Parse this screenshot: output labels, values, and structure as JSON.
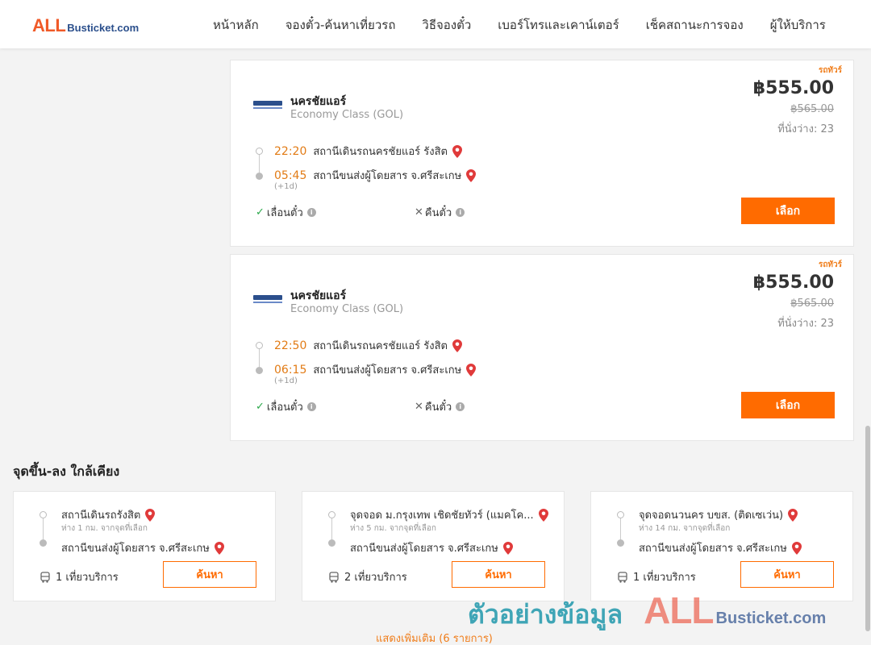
{
  "header": {
    "logo_all": "ALL",
    "logo_rest": "Busticket.com",
    "nav": [
      "หน้าหลัก",
      "จองตั๋ว-ค้นหาเที่ยวรถ",
      "วิธีจองตั๋ว",
      "เบอร์โทรและเคาน์เตอร์",
      "เช็คสถานะการจอง",
      "ผู้ให้บริการ"
    ]
  },
  "results": [
    {
      "badge": "รถทัวร์",
      "operator": "นครชัยแอร์",
      "class": "Economy Class (GOL)",
      "price": "฿555.00",
      "old_price": "฿565.00",
      "seats": "ที่นั่งว่าง: 23",
      "depart_time": "22:20",
      "depart_station": "สถานีเดินรถนครชัยแอร์ รังสิต",
      "arrive_time": "05:45",
      "arrive_station": "สถานีขนส่งผู้โดยสาร จ.ศรีสะเกษ",
      "next_day": "(+1d)",
      "reschedule": "เลื่อนตั๋ว",
      "refund": "คืนตั๋ว",
      "select_label": "เลือก"
    },
    {
      "badge": "รถทัวร์",
      "operator": "นครชัยแอร์",
      "class": "Economy Class (GOL)",
      "price": "฿555.00",
      "old_price": "฿565.00",
      "seats": "ที่นั่งว่าง: 23",
      "depart_time": "22:50",
      "depart_station": "สถานีเดินรถนครชัยแอร์ รังสิต",
      "arrive_time": "06:15",
      "arrive_station": "สถานีขนส่งผู้โดยสาร จ.ศรีสะเกษ",
      "next_day": "(+1d)",
      "reschedule": "เลื่อนตั๋ว",
      "refund": "คืนตั๋ว",
      "select_label": "เลือก"
    }
  ],
  "nearby": {
    "title": "จุดขึ้น-ลง ใกล้เคียง",
    "items": [
      {
        "from": "สถานีเดินรถรังสิต",
        "distance": "ห่าง 1 กม. จากจุดที่เลือก",
        "to": "สถานีขนส่งผู้โดยสาร จ.ศรีสะเกษ",
        "trips": "1 เที่ยวบริการ",
        "search_label": "ค้นหา"
      },
      {
        "from": "จุดจอด ม.กรุงเทพ เชิดชัยทัวร์ (แมคโค...",
        "distance": "ห่าง 5 กม. จากจุดที่เลือก",
        "to": "สถานีขนส่งผู้โดยสาร จ.ศรีสะเกษ",
        "trips": "2 เที่ยวบริการ",
        "search_label": "ค้นหา"
      },
      {
        "from": "จุดจอดนวนคร บขส. (ติดเซเว่น)",
        "distance": "ห่าง 14 กม. จากจุดที่เลือก",
        "to": "สถานีขนส่งผู้โดยสาร จ.ศรีสะเกษ",
        "trips": "1 เที่ยวบริการ",
        "search_label": "ค้นหา"
      }
    ],
    "show_more": "แสดงเพิ่มเติม (6 รายการ)"
  },
  "watermark": {
    "text": "ตัวอย่างข้อมูล",
    "logo_all": "ALL",
    "logo_rest": "Busticket.com"
  },
  "colors": {
    "accent": "#ff6b00",
    "time": "#e27b15",
    "pin": "#e03a3a",
    "check": "#2aa84a"
  }
}
